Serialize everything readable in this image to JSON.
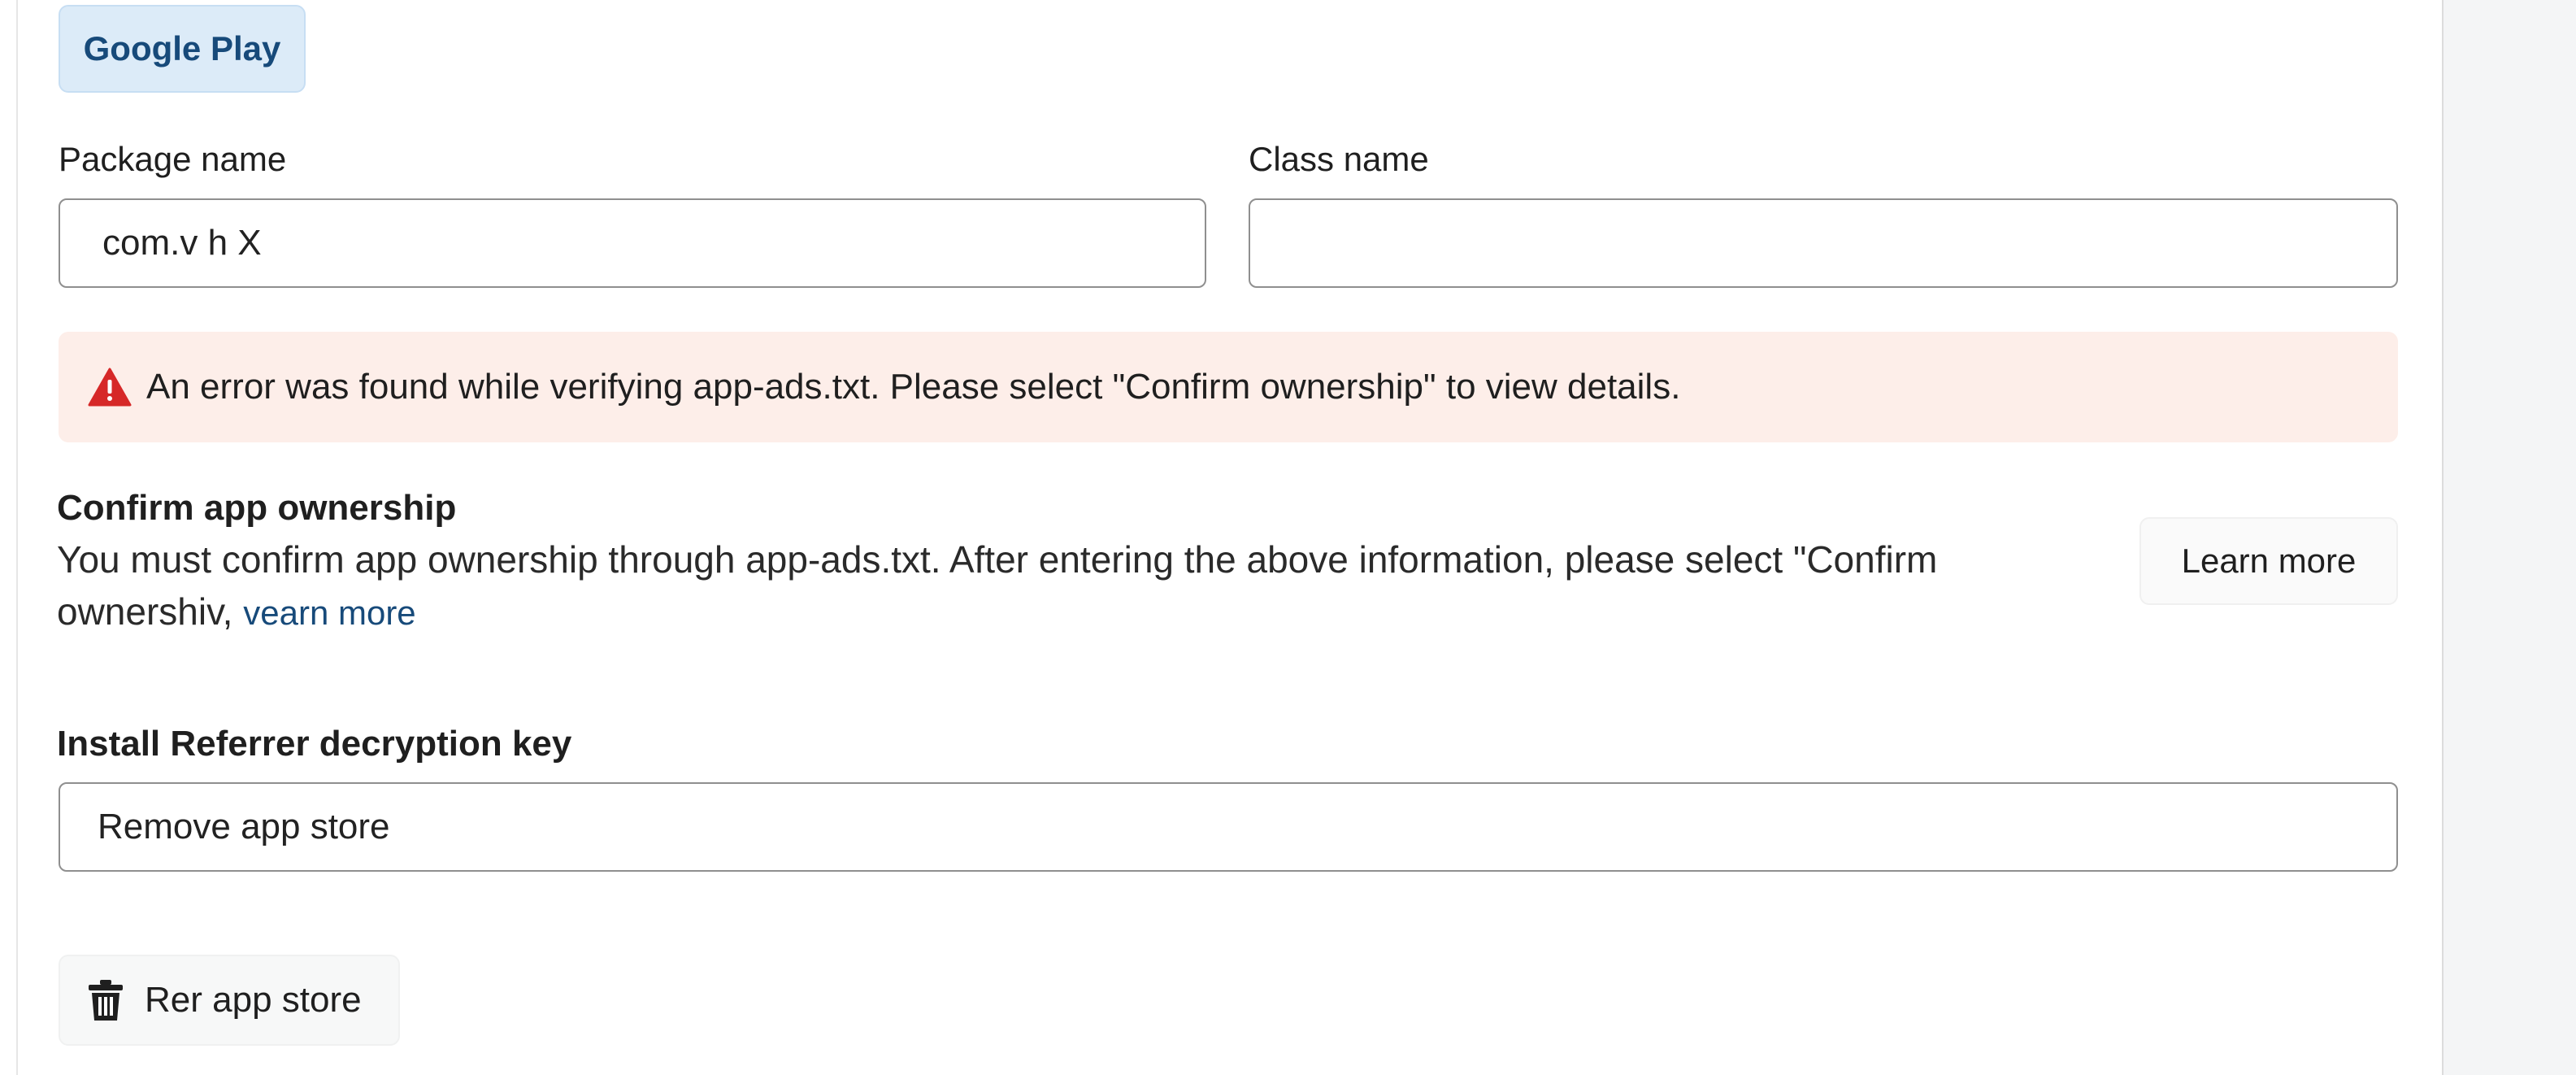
{
  "store_chip": {
    "label": "Google Play"
  },
  "package": {
    "label": "Package name",
    "value": "com.v h X"
  },
  "class": {
    "label": "Class name",
    "value": ""
  },
  "error": {
    "icon": "warning-triangle-icon",
    "message": "An error was found while verifying app-ads.txt. Please select \"Confirm ownership\" to view details.",
    "color": "#d62828"
  },
  "ownership": {
    "title": "Confirm app ownership",
    "description": "You must confirm app ownership through app-ads.txt.  After entering the above information, please select \"Confirm ownershiv,",
    "link": "vearn more",
    "learn_more": "Learn more"
  },
  "referrer": {
    "label": "Install Referrer decryption key",
    "value": "Remove app store"
  },
  "remove": {
    "icon": "trash-icon",
    "label": "Rer app store"
  },
  "colors": {
    "accent": "#174a7a",
    "error_bg": "#fdeee9",
    "chip_bg": "#dcebf8"
  }
}
